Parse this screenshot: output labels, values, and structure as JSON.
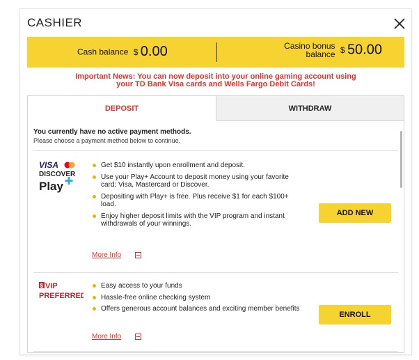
{
  "header": {
    "title": "CASHIER"
  },
  "balance": {
    "cash_label": "Cash balance",
    "cash_currency": "$",
    "cash_amount": "0.00",
    "bonus_label_1": "Casino bonus",
    "bonus_label_2": "balance",
    "bonus_currency": "$",
    "bonus_amount": "50.00"
  },
  "news": {
    "line1": "Important News: You can now deposit into your online gaming account using",
    "line2": "your TD Bank Visa cards and Wells Fargo Debit Cards!"
  },
  "tabs": {
    "deposit": "DEPOSIT",
    "withdraw": "WITHDRAW"
  },
  "status": {
    "no_methods": "You currently have no active payment methods.",
    "choose": "Please choose a payment method below to continue."
  },
  "methods": [
    {
      "logo_line1": "VISA",
      "logo_line2": "DISCOVER",
      "logo_line3": "Play",
      "bullets": [
        "Get $10 instantly upon enrollment and deposit.",
        "Use your Play+ Account to deposit money using your favorite card: Visa, Mastercard or Discover.",
        "Depositing with Play+ is free. Plus receive $1 for each $100+ load.",
        "Enjoy higher deposit limits with the VIP program and instant withdrawals of your winnings."
      ],
      "more": "More Info",
      "button": "ADD NEW"
    },
    {
      "logo_line1": "VIP",
      "logo_line2": "PREFERRED",
      "bullets": [
        "Easy access to your funds",
        "Hassle-free online checking system",
        "Offers generous account balances and exciting member benefits"
      ],
      "more": "More Info",
      "button": "ENROLL"
    }
  ],
  "colors": {
    "accent_yellow": "#f7d332",
    "accent_red": "#e0322b"
  }
}
